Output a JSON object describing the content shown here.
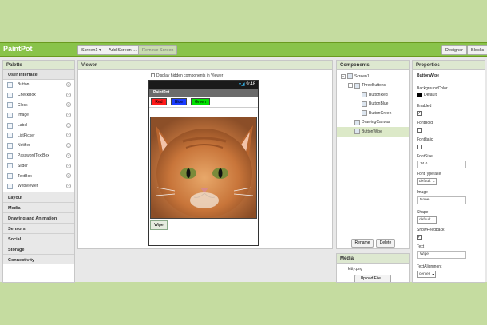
{
  "app": {
    "name": "PaintPot"
  },
  "toolbar": {
    "screen_select": "Screen1 ▾",
    "add_screen": "Add Screen ...",
    "remove_screen": "Remove Screen",
    "designer": "Designer",
    "blocks": "Blocks"
  },
  "palette": {
    "title": "Palette",
    "section": "User Interface",
    "items": [
      {
        "label": "Button",
        "icon": "button-icon"
      },
      {
        "label": "CheckBox",
        "icon": "checkbox-icon"
      },
      {
        "label": "Clock",
        "icon": "clock-icon"
      },
      {
        "label": "Image",
        "icon": "image-icon"
      },
      {
        "label": "Label",
        "icon": "label-icon"
      },
      {
        "label": "ListPicker",
        "icon": "listpicker-icon"
      },
      {
        "label": "Notifier",
        "icon": "notifier-icon"
      },
      {
        "label": "PasswordTextBox",
        "icon": "password-icon"
      },
      {
        "label": "Slider",
        "icon": "slider-icon"
      },
      {
        "label": "TextBox",
        "icon": "textbox-icon"
      },
      {
        "label": "WebViewer",
        "icon": "webviewer-icon"
      }
    ],
    "categories": [
      "Layout",
      "Media",
      "Drawing and Animation",
      "Sensors",
      "Social",
      "Storage",
      "Connectivity"
    ]
  },
  "viewer": {
    "title": "Viewer",
    "hidden_toggle": "Display hidden components in Viewer",
    "phone": {
      "time": "9:48",
      "screen_title": "PaintPot",
      "buttons": [
        {
          "label": "Red",
          "color": "#ff1a1a"
        },
        {
          "label": "Blue",
          "color": "#1a3cff"
        },
        {
          "label": "Green",
          "color": "#00e000"
        }
      ],
      "wipe": "Wipe"
    }
  },
  "components": {
    "title": "Components",
    "tree": [
      {
        "label": "Screen1",
        "level": 0,
        "toggle": "⊟"
      },
      {
        "label": "ThreeButtons",
        "level": 1,
        "toggle": "⊟"
      },
      {
        "label": "ButtonRed",
        "level": 2
      },
      {
        "label": "ButtonBlue",
        "level": 2
      },
      {
        "label": "ButtonGreen",
        "level": 2
      },
      {
        "label": "DrawingCanvas",
        "level": 1
      },
      {
        "label": "ButtonWipe",
        "level": 1,
        "selected": true
      }
    ],
    "rename": "Rename",
    "delete": "Delete"
  },
  "media": {
    "title": "Media",
    "file": "kitty.png",
    "upload": "Upload File ..."
  },
  "properties": {
    "title": "Properties",
    "component": "ButtonWipe",
    "background_color_label": "BackgroundColor",
    "background_color_value": "Default",
    "enabled_label": "Enabled",
    "enabled": true,
    "fontbold_label": "FontBold",
    "fontbold": false,
    "fontitalic_label": "FontItalic",
    "fontitalic": false,
    "fontsize_label": "FontSize",
    "fontsize_value": "14.0",
    "typeface_label": "FontTypeface",
    "typeface_value": "default",
    "image_label": "Image",
    "image_value": "None...",
    "shape_label": "Shape",
    "shape_value": "default",
    "showfeedback_label": "ShowFeedback",
    "showfeedback": true,
    "text_label": "Text",
    "text_value": "Wipe",
    "textalign_label": "TextAlignment",
    "textalign_value": "center"
  },
  "colors": {
    "brand": "#89c34a",
    "page_bg": "#c5dca0"
  }
}
